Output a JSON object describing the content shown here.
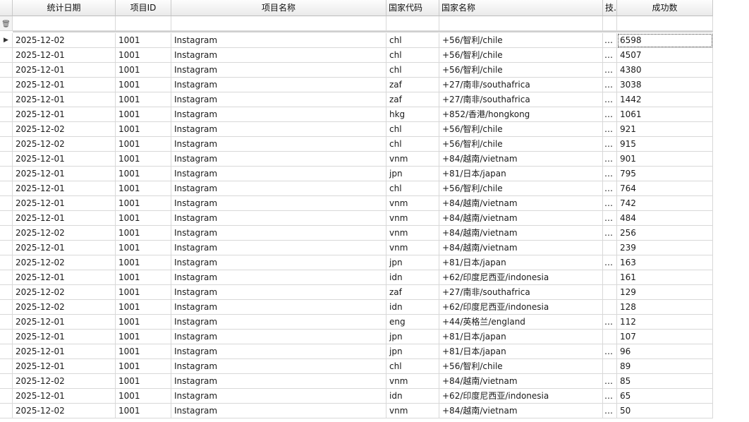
{
  "columns": [
    "统计日期",
    "项目ID",
    "项目名称",
    "国家代码",
    "国家名称",
    "技…",
    "成功数"
  ],
  "filter_icon": "filter-icon",
  "rows": [
    {
      "date": "2025-12-02",
      "pid": "1001",
      "pname": "Instagram",
      "code": "chl",
      "country": "+56/智利/chile",
      "trunc": "…",
      "count": "6598"
    },
    {
      "date": "2025-12-01",
      "pid": "1001",
      "pname": "Instagram",
      "code": "chl",
      "country": "+56/智利/chile",
      "trunc": "…",
      "count": "4507"
    },
    {
      "date": "2025-12-01",
      "pid": "1001",
      "pname": "Instagram",
      "code": "chl",
      "country": "+56/智利/chile",
      "trunc": "…",
      "count": "4380"
    },
    {
      "date": "2025-12-01",
      "pid": "1001",
      "pname": "Instagram",
      "code": "zaf",
      "country": "+27/南非/southafrica",
      "trunc": "…",
      "count": "3038"
    },
    {
      "date": "2025-12-01",
      "pid": "1001",
      "pname": "Instagram",
      "code": "zaf",
      "country": "+27/南非/southafrica",
      "trunc": "…",
      "count": "1442"
    },
    {
      "date": "2025-12-01",
      "pid": "1001",
      "pname": "Instagram",
      "code": "hkg",
      "country": "+852/香港/hongkong",
      "trunc": "…",
      "count": "1061"
    },
    {
      "date": "2025-12-02",
      "pid": "1001",
      "pname": "Instagram",
      "code": "chl",
      "country": "+56/智利/chile",
      "trunc": "…",
      "count": "921"
    },
    {
      "date": "2025-12-02",
      "pid": "1001",
      "pname": "Instagram",
      "code": "chl",
      "country": "+56/智利/chile",
      "trunc": "…",
      "count": "915"
    },
    {
      "date": "2025-12-01",
      "pid": "1001",
      "pname": "Instagram",
      "code": "vnm",
      "country": "+84/越南/vietnam",
      "trunc": "…",
      "count": "901"
    },
    {
      "date": "2025-12-01",
      "pid": "1001",
      "pname": "Instagram",
      "code": "jpn",
      "country": "+81/日本/japan",
      "trunc": "…",
      "count": "795"
    },
    {
      "date": "2025-12-01",
      "pid": "1001",
      "pname": "Instagram",
      "code": "chl",
      "country": "+56/智利/chile",
      "trunc": "…",
      "count": "764"
    },
    {
      "date": "2025-12-01",
      "pid": "1001",
      "pname": "Instagram",
      "code": "vnm",
      "country": "+84/越南/vietnam",
      "trunc": "…",
      "count": "742"
    },
    {
      "date": "2025-12-01",
      "pid": "1001",
      "pname": "Instagram",
      "code": "vnm",
      "country": "+84/越南/vietnam",
      "trunc": "…",
      "count": "484"
    },
    {
      "date": "2025-12-02",
      "pid": "1001",
      "pname": "Instagram",
      "code": "vnm",
      "country": "+84/越南/vietnam",
      "trunc": "…",
      "count": "256"
    },
    {
      "date": "2025-12-01",
      "pid": "1001",
      "pname": "Instagram",
      "code": "vnm",
      "country": "+84/越南/vietnam",
      "trunc": "",
      "count": "239"
    },
    {
      "date": "2025-12-02",
      "pid": "1001",
      "pname": "Instagram",
      "code": "jpn",
      "country": "+81/日本/japan",
      "trunc": "…",
      "count": "163"
    },
    {
      "date": "2025-12-01",
      "pid": "1001",
      "pname": "Instagram",
      "code": "idn",
      "country": "+62/印度尼西亚/indonesia",
      "trunc": "",
      "count": "161"
    },
    {
      "date": "2025-12-02",
      "pid": "1001",
      "pname": "Instagram",
      "code": "zaf",
      "country": "+27/南非/southafrica",
      "trunc": "",
      "count": "129"
    },
    {
      "date": "2025-12-02",
      "pid": "1001",
      "pname": "Instagram",
      "code": "idn",
      "country": "+62/印度尼西亚/indonesia",
      "trunc": "",
      "count": "128"
    },
    {
      "date": "2025-12-01",
      "pid": "1001",
      "pname": "Instagram",
      "code": "eng",
      "country": "+44/英格兰/england",
      "trunc": "…",
      "count": "112"
    },
    {
      "date": "2025-12-01",
      "pid": "1001",
      "pname": "Instagram",
      "code": "jpn",
      "country": "+81/日本/japan",
      "trunc": "",
      "count": "107"
    },
    {
      "date": "2025-12-01",
      "pid": "1001",
      "pname": "Instagram",
      "code": "jpn",
      "country": "+81/日本/japan",
      "trunc": "…",
      "count": "96"
    },
    {
      "date": "2025-12-01",
      "pid": "1001",
      "pname": "Instagram",
      "code": "chl",
      "country": "+56/智利/chile",
      "trunc": "",
      "count": "89"
    },
    {
      "date": "2025-12-02",
      "pid": "1001",
      "pname": "Instagram",
      "code": "vnm",
      "country": "+84/越南/vietnam",
      "trunc": "…",
      "count": "85"
    },
    {
      "date": "2025-12-01",
      "pid": "1001",
      "pname": "Instagram",
      "code": "idn",
      "country": "+62/印度尼西亚/indonesia",
      "trunc": "…",
      "count": "65"
    },
    {
      "date": "2025-12-02",
      "pid": "1001",
      "pname": "Instagram",
      "code": "vnm",
      "country": "+84/越南/vietnam",
      "trunc": "…",
      "count": "50"
    }
  ]
}
